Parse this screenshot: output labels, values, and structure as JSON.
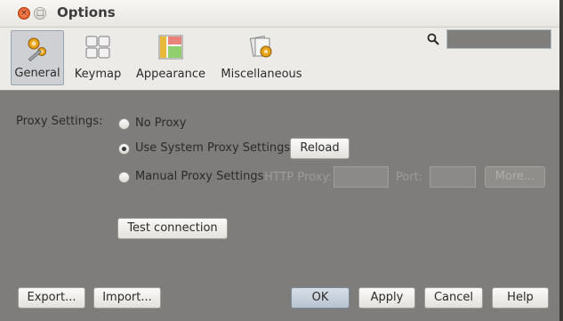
{
  "window": {
    "title": "Options"
  },
  "window_controls": {
    "close_glyph": "×",
    "maximize_glyph": "□"
  },
  "categories": [
    {
      "label": "General",
      "icon": "gears-wrench-icon",
      "selected": true
    },
    {
      "label": "Keymap",
      "icon": "keyboard-icon",
      "selected": false
    },
    {
      "label": "Appearance",
      "icon": "appearance-icon",
      "selected": false
    },
    {
      "label": "Miscellaneous",
      "icon": "misc-icon",
      "selected": false
    }
  ],
  "search": {
    "value": ""
  },
  "proxy": {
    "section_label": "Proxy Settings:",
    "options": [
      {
        "label": "No Proxy",
        "checked": false
      },
      {
        "label": "Use System Proxy Settings",
        "checked": true
      },
      {
        "label": "Manual Proxy Settings",
        "checked": false
      }
    ],
    "reload_label": "Reload",
    "http_proxy_label": "HTTP Proxy:",
    "port_label": "Port:",
    "more_label": "More...",
    "http_proxy_value": "",
    "port_value": ""
  },
  "test_connection_label": "Test connection",
  "footer": {
    "export_label": "Export...",
    "import_label": "Import...",
    "ok_label": "OK",
    "apply_label": "Apply",
    "cancel_label": "Cancel",
    "help_label": "Help"
  },
  "colors": {
    "panel_bg": "#7e7d7b",
    "toolbar_bg": "#edebe8",
    "selected_tab_bg": "#cfd0d3",
    "close_button": "#df4a16"
  }
}
